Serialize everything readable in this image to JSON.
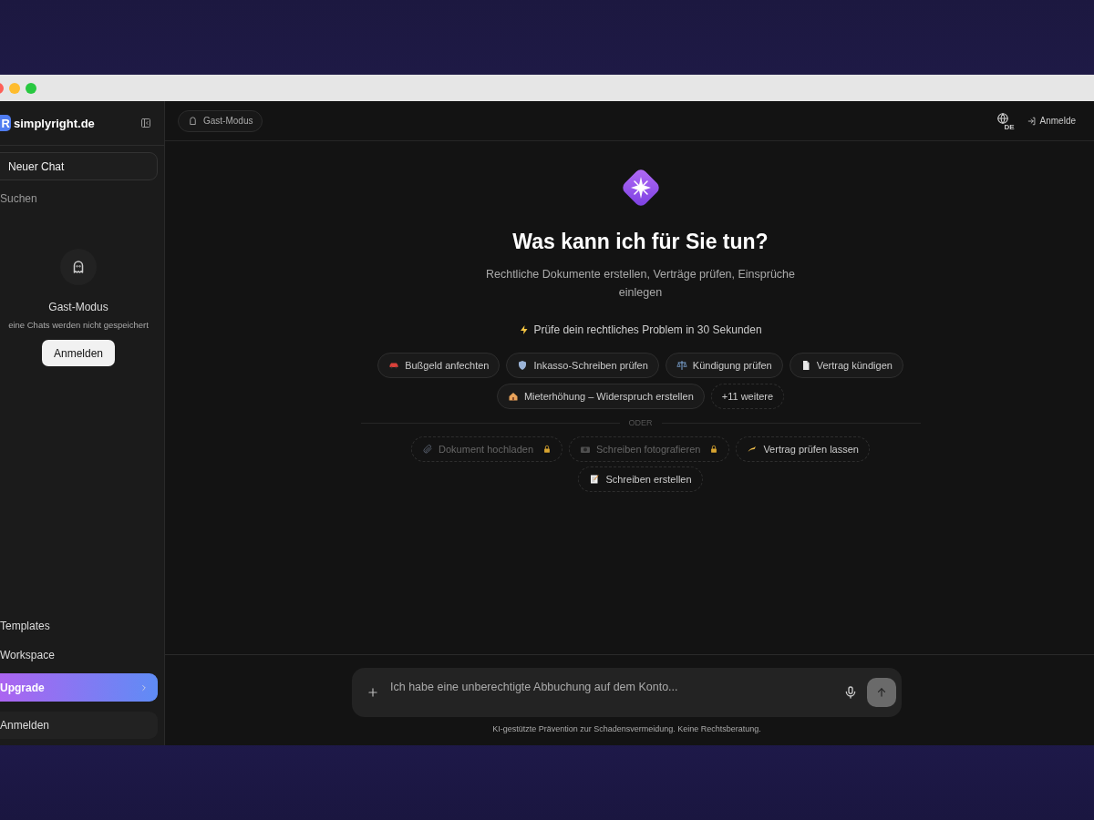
{
  "sidebar": {
    "logo_letter": "R",
    "brand": "simplyright.de",
    "new_chat": "Neuer Chat",
    "search": "Suchen",
    "guest": {
      "title": "Gast-Modus",
      "note": "eine Chats werden nicht gespeichert",
      "button": "Anmelden"
    },
    "items": [
      {
        "label": "Templates",
        "kind": "link"
      },
      {
        "label": "Workspace",
        "kind": "link"
      },
      {
        "label": "Upgrade",
        "kind": "upgrade"
      },
      {
        "label": "Anmelden",
        "kind": "login"
      }
    ]
  },
  "topbar": {
    "mode_badge": "Gast-Modus",
    "language": "DE",
    "login": "Anmelde"
  },
  "hero": {
    "title": "Was kann ich für Sie tun?",
    "subtitle": "Rechtliche Dokumente erstellen, Verträge prüfen, Einsprüche einlegen",
    "tagline": "Prüfe dein rechtliches Problem in 30 Sekunden"
  },
  "suggestions": [
    {
      "label": "Bußgeld anfechten",
      "kind": "topic"
    },
    {
      "label": "Inkasso-Schreiben prüfen",
      "kind": "topic"
    },
    {
      "label": "Kündigung prüfen",
      "kind": "topic"
    },
    {
      "label": "Vertrag kündigen",
      "kind": "topic"
    },
    {
      "label": "Mieterhöhung – Widerspruch erstellen",
      "kind": "topic"
    },
    {
      "label": "+11 weitere",
      "kind": "more"
    }
  ],
  "divider": "ODER",
  "actions": [
    {
      "label": "Dokument hochladen",
      "locked": true
    },
    {
      "label": "Schreiben fotografieren",
      "locked": true
    },
    {
      "label": "Vertrag prüfen lassen",
      "locked": false
    },
    {
      "label": "Schreiben erstellen",
      "locked": false
    }
  ],
  "composer": {
    "placeholder": "Ich habe eine unberechtigte Abbuchung auf dem Konto...",
    "disclaimer": "KI-gestützte Prävention zur Schadensvermeidung. Keine Rechtsberatung."
  }
}
